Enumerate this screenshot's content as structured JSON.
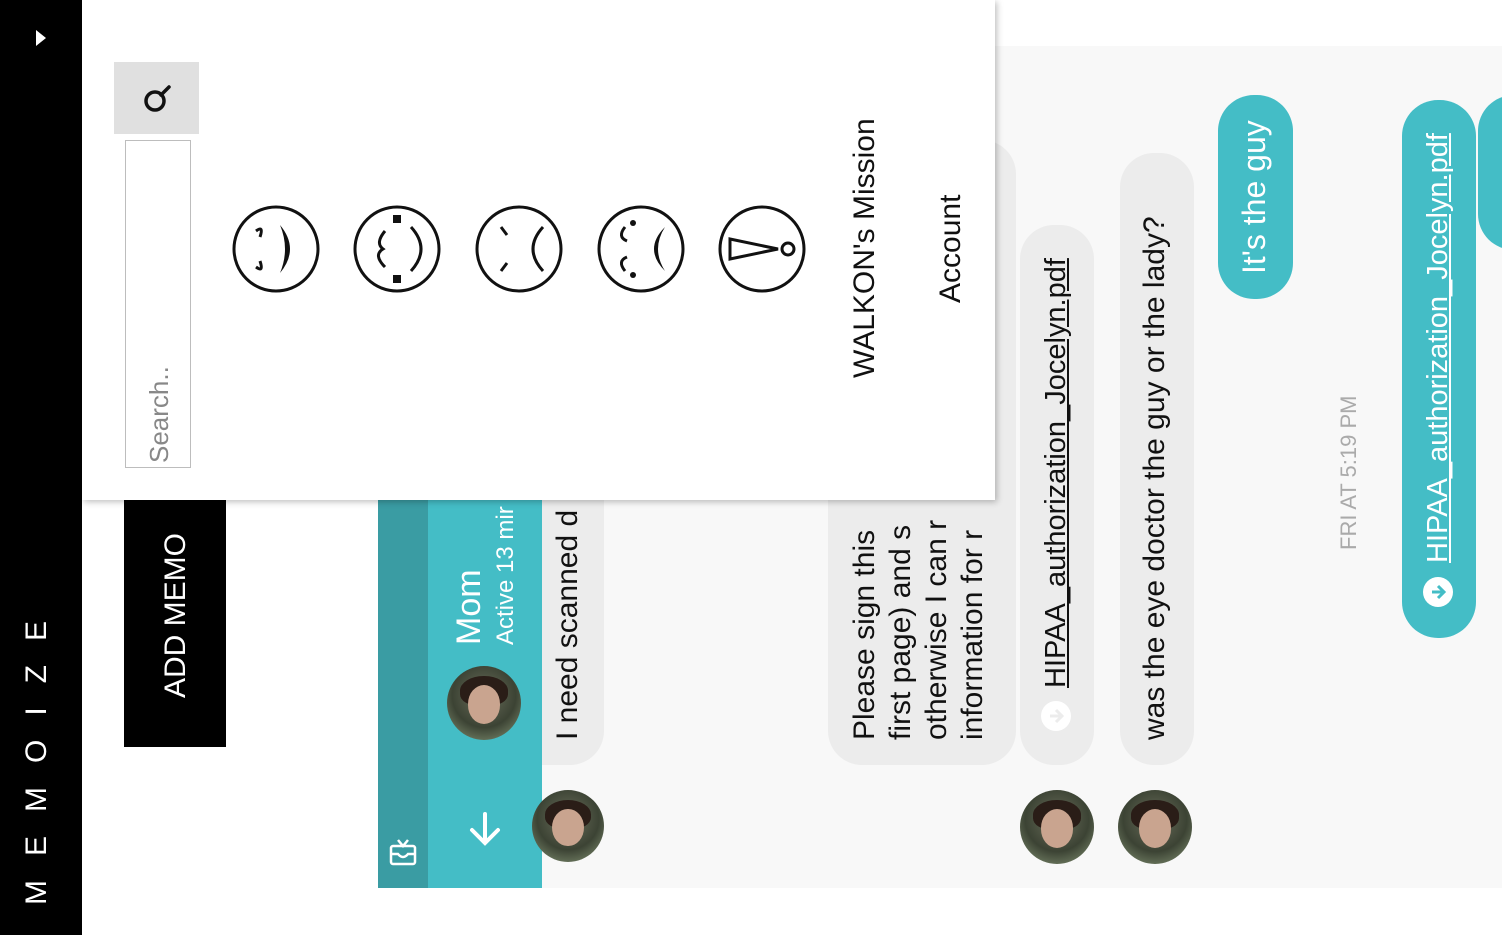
{
  "app": {
    "name": "MEMOIZE"
  },
  "sidebar": {
    "toggle_icon": "play-icon"
  },
  "add_memo": {
    "label": "ADD MEMO"
  },
  "menu": {
    "search_placeholder": "Search..",
    "mission_label": "WALKON's Mission",
    "account_label": "Account",
    "emotions": [
      "laughing-face-icon",
      "confused-face-icon",
      "sad-face-icon",
      "crying-face-icon",
      "exclaiming-face-icon"
    ]
  },
  "chat": {
    "contact_name": "Mom",
    "contact_status": "Active 13 mir",
    "messages": {
      "m1": "I need scanned d",
      "m2_line1": "Please sign this",
      "m2_line2": "first page) and s",
      "m2_line3": "otherwise I can r",
      "m2_line4": "information for r",
      "m3_file": "HIPAA_authorization_Jocelyn.pdf",
      "m4": "was the eye doctor the guy or the lady?",
      "m5": "It's the guy",
      "timestamp": "FRI AT 5:19 PM",
      "m6_file": "HIPAA_authorization_Jocelyn.pdf"
    }
  },
  "colors": {
    "accent": "#44bdc6",
    "accent_dark": "#3a9ca3",
    "sidebar": "#000000",
    "chat_bg": "#f8f8f8",
    "bubble_in": "#ececec"
  }
}
